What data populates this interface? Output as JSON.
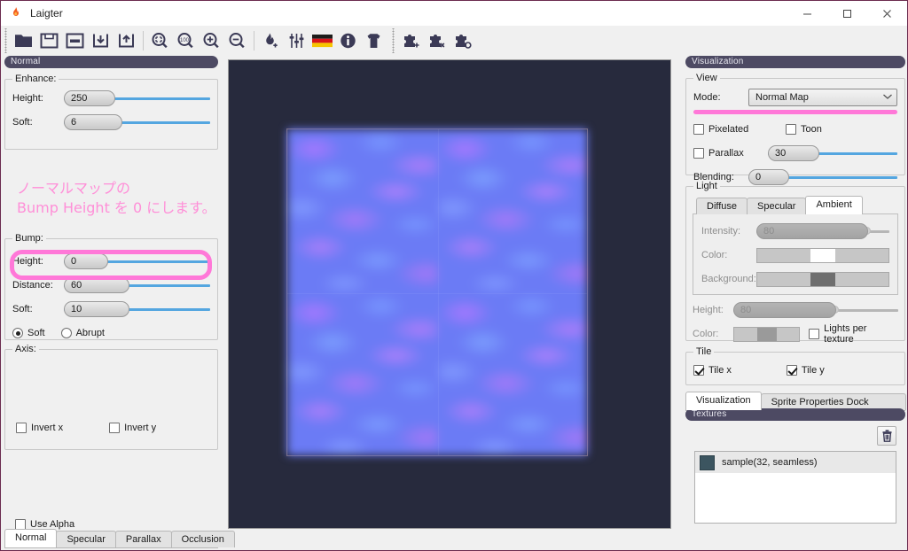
{
  "window": {
    "title": "Laigter",
    "icon": "flame-icon",
    "minimize_label": "–",
    "maximize_label": "□",
    "close_label": "✕"
  },
  "toolbar": {
    "groups": [
      {
        "items": [
          {
            "name": "open-project-icon",
            "label": "Open"
          },
          {
            "name": "save-project-icon",
            "label": "Save"
          },
          {
            "name": "save-as-project-icon",
            "label": "Save As"
          },
          {
            "name": "import-icon",
            "label": "Import"
          },
          {
            "name": "export-icon",
            "label": "Export"
          }
        ]
      },
      {
        "items": [
          {
            "name": "zoom-fit-icon",
            "label": "Fit"
          },
          {
            "name": "zoom-100-icon",
            "label": "100%"
          },
          {
            "name": "zoom-in-icon",
            "label": "Zoom In"
          },
          {
            "name": "zoom-out-icon",
            "label": "Zoom Out"
          }
        ]
      },
      {
        "items": [
          {
            "name": "add-flame-icon",
            "label": "New"
          },
          {
            "name": "settings-sliders-icon",
            "label": "Settings"
          },
          {
            "name": "german-flag-icon",
            "label": "Language"
          },
          {
            "name": "info-icon",
            "label": "About"
          },
          {
            "name": "shirt-icon",
            "label": "Presets"
          }
        ]
      },
      {
        "items": [
          {
            "name": "add-plugin-icon",
            "label": "Add Plugin"
          },
          {
            "name": "remove-plugin-icon",
            "label": "Remove Plugin"
          },
          {
            "name": "configure-plugin-icon",
            "label": "Configure Plugin"
          }
        ]
      }
    ]
  },
  "left_panel": {
    "dock_title": "Normal",
    "enhance": {
      "label": "Enhance:",
      "height": {
        "label": "Height:",
        "value": "250",
        "fill_pct": 16
      },
      "soft": {
        "label": "Soft:",
        "value": "6",
        "fill_pct": 25
      }
    },
    "annotation": {
      "line1": "ノーマルマップの",
      "line2": "Bump Height を 0 にします。",
      "color": "#ff8fd8"
    },
    "bump": {
      "label": "Bump:",
      "height": {
        "label": "Height:",
        "value": "0",
        "fill_pct": 13
      },
      "distance": {
        "label": "Distance:",
        "value": "60",
        "fill_pct": 38
      },
      "soft": {
        "label": "Soft:",
        "value": "10",
        "fill_pct": 38
      },
      "mode_soft": {
        "label": "Soft",
        "selected": true
      },
      "mode_abrupt": {
        "label": "Abrupt",
        "selected": false
      },
      "highlight_color": "#ff78d8"
    },
    "axis": {
      "label": "Axis:",
      "invert_x": {
        "label": "Invert x",
        "checked": false
      },
      "invert_y": {
        "label": "Invert y",
        "checked": false
      }
    },
    "use_alpha": {
      "label": "Use Alpha",
      "checked": false
    },
    "tabs": [
      {
        "label": "Normal",
        "active": true
      },
      {
        "label": "Specular",
        "active": false
      },
      {
        "label": "Parallax",
        "active": false
      },
      {
        "label": "Occlusion",
        "active": false
      }
    ]
  },
  "right_panel": {
    "dock_title": "Visualization",
    "view": {
      "label": "View",
      "mode": {
        "label": "Mode:",
        "value": "Normal Map",
        "caret": "⌄"
      },
      "highlight_color": "#ff78d8",
      "pixelated": {
        "label": "Pixelated",
        "checked": false
      },
      "toon": {
        "label": "Toon",
        "checked": false
      },
      "parallax": {
        "label": "Parallax",
        "checked": false,
        "value": "30",
        "fill_pct": 38
      },
      "blending": {
        "label": "Blending:",
        "value": "0",
        "fill_pct": 25
      }
    },
    "light": {
      "label": "Light",
      "tabs": [
        {
          "label": "Diffuse",
          "active": false
        },
        {
          "label": "Specular",
          "active": false
        },
        {
          "label": "Ambient",
          "active": true
        }
      ],
      "intensity": {
        "label": "Intensity:",
        "value": "80",
        "fill_pct": 80,
        "disabled": true
      },
      "color": {
        "label": "Color:",
        "swatch": "#ffffff",
        "disabled": true
      },
      "background": {
        "label": "Background:",
        "swatch": "#6e6e6e",
        "disabled": true
      },
      "height": {
        "label": "Height:",
        "value": "80",
        "fill_pct": 62,
        "disabled": true
      },
      "light_color": {
        "label": "Color:",
        "swatch": "#9a9a9a",
        "disabled": true
      },
      "lights_per_texture": {
        "label": "Lights per texture",
        "checked": false
      }
    },
    "tile": {
      "label": "Tile",
      "tile_x": {
        "label": "Tile x",
        "checked": true
      },
      "tile_y": {
        "label": "Tile y",
        "checked": true
      }
    },
    "tabs": [
      {
        "label": "Visualization",
        "active": true
      },
      {
        "label": "Sprite Properties Dock Widget",
        "active": false
      }
    ]
  },
  "textures": {
    "dock_title": "Textures",
    "delete_icon": "trash-icon",
    "items": [
      {
        "name": "sample(32, seamless)",
        "thumb_color": "#3c5560",
        "selected": true
      }
    ]
  },
  "preview": {
    "name": "normal-map-preview",
    "background": "#272a3d"
  }
}
